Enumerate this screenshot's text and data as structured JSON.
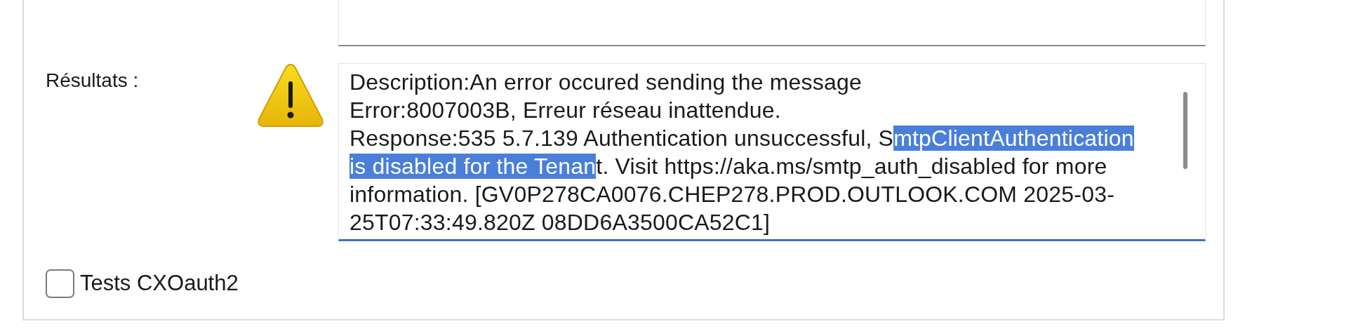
{
  "results": {
    "label": "Résultats :",
    "lines": [
      [
        {
          "text": "Description:An error occured sending the message",
          "selected": false
        }
      ],
      [
        {
          "text": "Error:8007003B, Erreur réseau inattendue.",
          "selected": false
        }
      ],
      [
        {
          "text": "Response:535 5.7.139 Authentication unsuccessful, S",
          "selected": false
        },
        {
          "text": "mtpClientAuthentication",
          "selected": true
        }
      ],
      [
        {
          "text": "is disabled for the Tenan",
          "selected": true
        },
        {
          "text": "t. Visit https://aka.ms/smtp_auth_disabled for more",
          "selected": false
        }
      ],
      [
        {
          "text": "information. [GV0P278CA0076.CHEP278.PROD.OUTLOOK.COM 2025-03-",
          "selected": false
        }
      ],
      [
        {
          "text": "25T07:33:49.820Z 08DD6A3500CA52C1]",
          "selected": false
        }
      ]
    ]
  },
  "checkbox": {
    "label": "Tests CXOauth2",
    "checked": false
  }
}
